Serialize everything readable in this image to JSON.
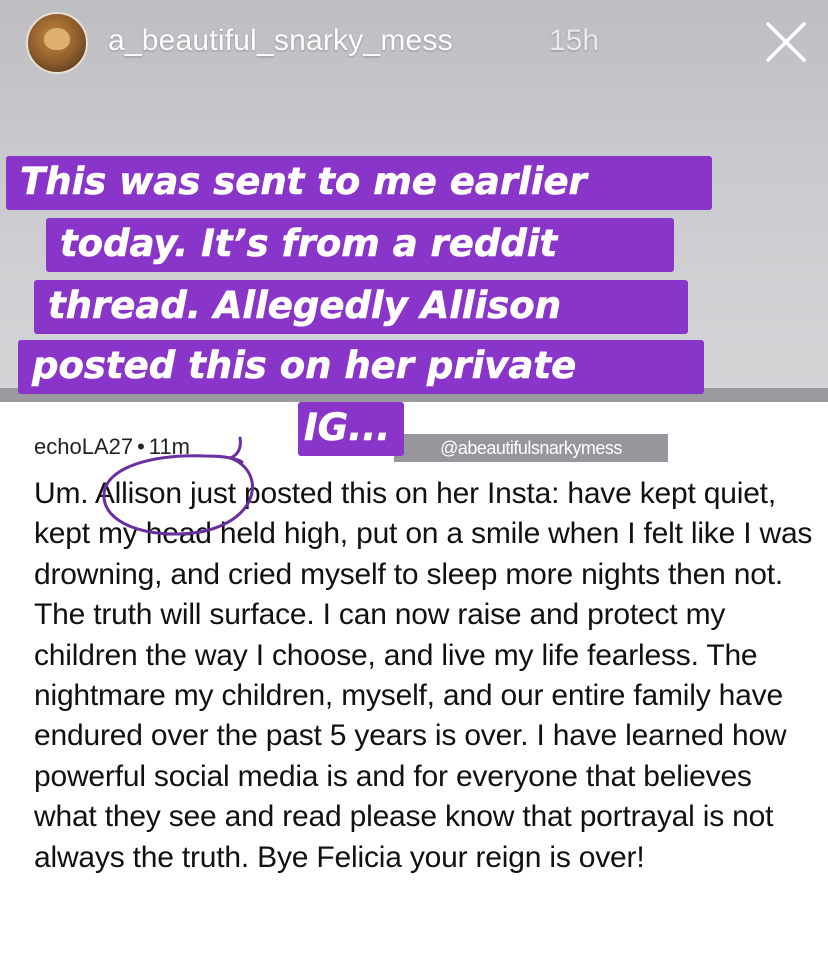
{
  "story": {
    "username": "a_beautiful_snarky_mess",
    "time_ago": "15h",
    "close_icon": "close-icon",
    "caption_lines": [
      "This was sent to me earlier",
      "today. It’s from a reddit",
      "thread. Allegedly Allison",
      "posted this on her private",
      "IG..."
    ],
    "caption_color": "#8a35c9"
  },
  "screenshot": {
    "watermark": "@abeautifulsnarkymess",
    "author": "echoLA27",
    "separator": "•",
    "time_partial": "11m",
    "body": "Um. Allison just posted this on her Insta:  have kept quiet, kept my head held high, put on a smile when I felt like I was drowning, and cried myself to sleep more nights then not. The truth will surface. I can now raise and protect my children the way I choose, and live my life fearless. The nightmare my children, myself, and our entire family have endured over the past 5 years is over. I have learned how powerful social media is and for everyone that believes what they see and read please know that portrayal is not always the truth. Bye Felicia your reign is over!"
  }
}
